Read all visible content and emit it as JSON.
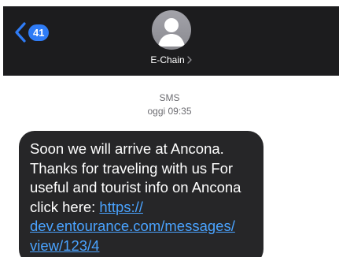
{
  "header": {
    "back_badge": "41",
    "contact_name": "E-Chain",
    "contact_chevron": "›"
  },
  "meta": {
    "label": "SMS",
    "time": "oggi 09:35"
  },
  "message": {
    "line1": "Soon we will arrive at Ancona.",
    "line2": "Thanks for traveling with us For",
    "line3": "useful and tourist info on Ancona",
    "line4_text": "click here: ",
    "line4_link": "https://",
    "link_line2": "dev.entourance.com/messages/",
    "link_line3": "view/123/4"
  },
  "colors": {
    "header_bg": "#1c1c1e",
    "bubble_bg": "#262628",
    "link": "#4aa3ff",
    "badge": "#2f7cf6"
  },
  "icons": {
    "back": "chevron-left-icon",
    "avatar": "person-silhouette-icon",
    "contact": "chevron-right-icon"
  }
}
